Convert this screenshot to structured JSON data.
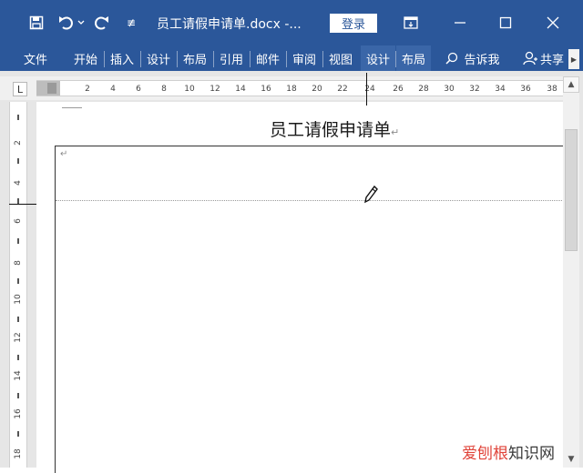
{
  "titlebar": {
    "doc_title": "员工请假申请单.docx  -...",
    "login_label": "登录",
    "qat_customize": "≢"
  },
  "ribbon": {
    "tabs": [
      {
        "label": "文件"
      },
      {
        "label": "开始"
      },
      {
        "label": "插入"
      },
      {
        "label": "设计"
      },
      {
        "label": "布局"
      },
      {
        "label": "引用"
      },
      {
        "label": "邮件"
      },
      {
        "label": "审阅"
      },
      {
        "label": "视图"
      },
      {
        "label": "设计"
      },
      {
        "label": "布局"
      }
    ],
    "tell_me": "告诉我",
    "share": "共享"
  },
  "ruler": {
    "tab_selector": "L",
    "h_ticks": [
      "2",
      "4",
      "6",
      "8",
      "10",
      "12",
      "14",
      "16",
      "18",
      "20",
      "22",
      "24",
      "26",
      "28",
      "30",
      "32",
      "34",
      "36",
      "38"
    ],
    "v_ticks": [
      "2",
      "4",
      "6",
      "8",
      "10",
      "12",
      "14",
      "16",
      "18"
    ]
  },
  "document": {
    "title": "员工请假申请单",
    "para_mark": "↵"
  },
  "watermark": {
    "accent": "爱刨根",
    "rest": "知识网"
  },
  "colors": {
    "accent": "#2b579a",
    "contextual_tab": "#3a66a8"
  }
}
